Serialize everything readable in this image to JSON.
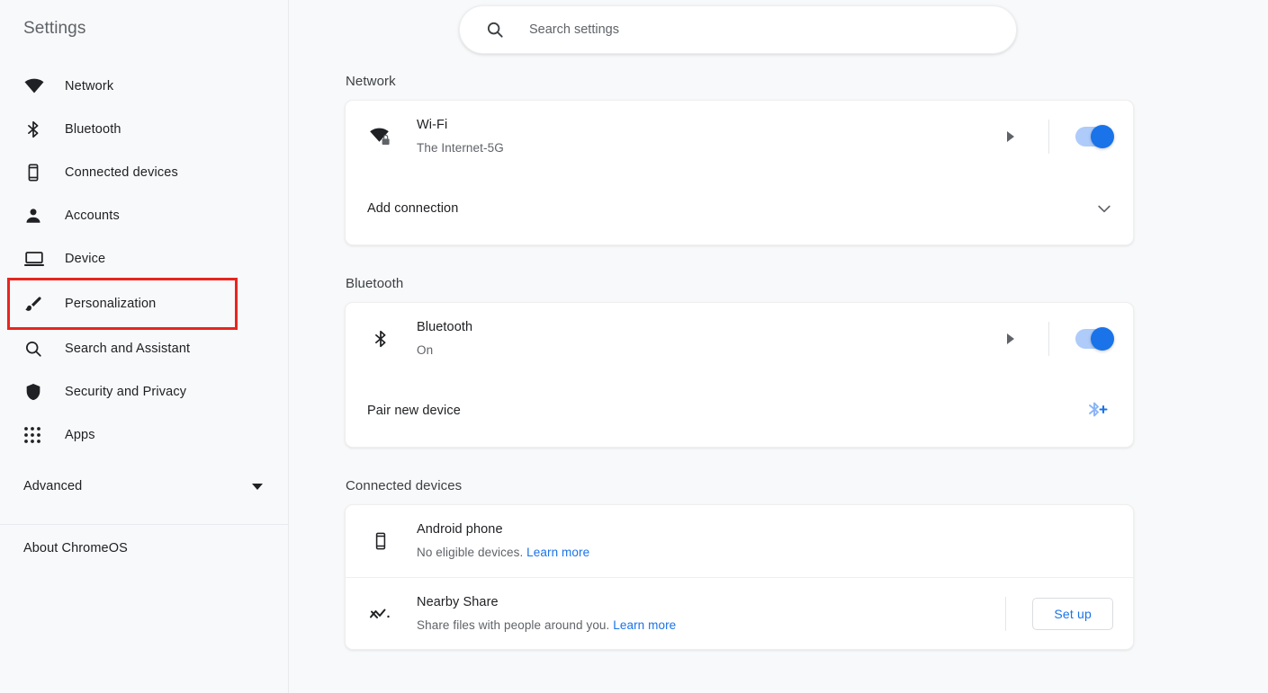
{
  "sidebar": {
    "title": "Settings",
    "items": [
      {
        "label": "Network",
        "icon": "wifi-icon"
      },
      {
        "label": "Bluetooth",
        "icon": "bluetooth-icon"
      },
      {
        "label": "Connected devices",
        "icon": "phone-icon"
      },
      {
        "label": "Accounts",
        "icon": "person-icon"
      },
      {
        "label": "Device",
        "icon": "laptop-icon"
      },
      {
        "label": "Personalization",
        "icon": "paintbrush-icon"
      },
      {
        "label": "Search and Assistant",
        "icon": "search-icon"
      },
      {
        "label": "Security and Privacy",
        "icon": "shield-icon"
      },
      {
        "label": "Apps",
        "icon": "apps-grid-icon"
      }
    ],
    "highlighted_item": "Personalization",
    "highlight_color": "#e8251f",
    "advanced": {
      "label": "Advanced",
      "icon": "chevron-down-icon"
    },
    "about": {
      "label": "About ChromeOS"
    }
  },
  "search": {
    "placeholder": "Search settings",
    "value": "",
    "icon": "search-icon"
  },
  "sections": [
    {
      "title": "Network",
      "rows": [
        {
          "icon": "wifi-locked-icon",
          "title": "Wi-Fi",
          "subtitle": "The Internet-5G",
          "arrow": true,
          "toggle_on": true
        }
      ],
      "footer_row": {
        "label": "Add connection",
        "icon": "chevron-down-icon"
      }
    },
    {
      "title": "Bluetooth",
      "rows": [
        {
          "icon": "bluetooth-icon",
          "title": "Bluetooth",
          "subtitle": "On",
          "arrow": true,
          "toggle_on": true
        }
      ],
      "footer_row": {
        "label": "Pair new device",
        "icon": "bluetooth-add-icon"
      }
    },
    {
      "title": "Connected devices",
      "rows": [
        {
          "icon": "phone-icon",
          "title": "Android phone",
          "subtitle": "No eligible devices.",
          "link_text": "Learn more"
        },
        {
          "icon": "nearby-share-icon",
          "title": "Nearby Share",
          "subtitle": "Share files with people around you.",
          "link_text": "Learn more",
          "button_label": "Set up"
        }
      ]
    }
  ],
  "colors": {
    "accent": "#1a73e8",
    "toggle_track": "#aecbfa",
    "background": "#f8f9fa",
    "card": "#ffffff",
    "highlight": "#e8251f"
  }
}
